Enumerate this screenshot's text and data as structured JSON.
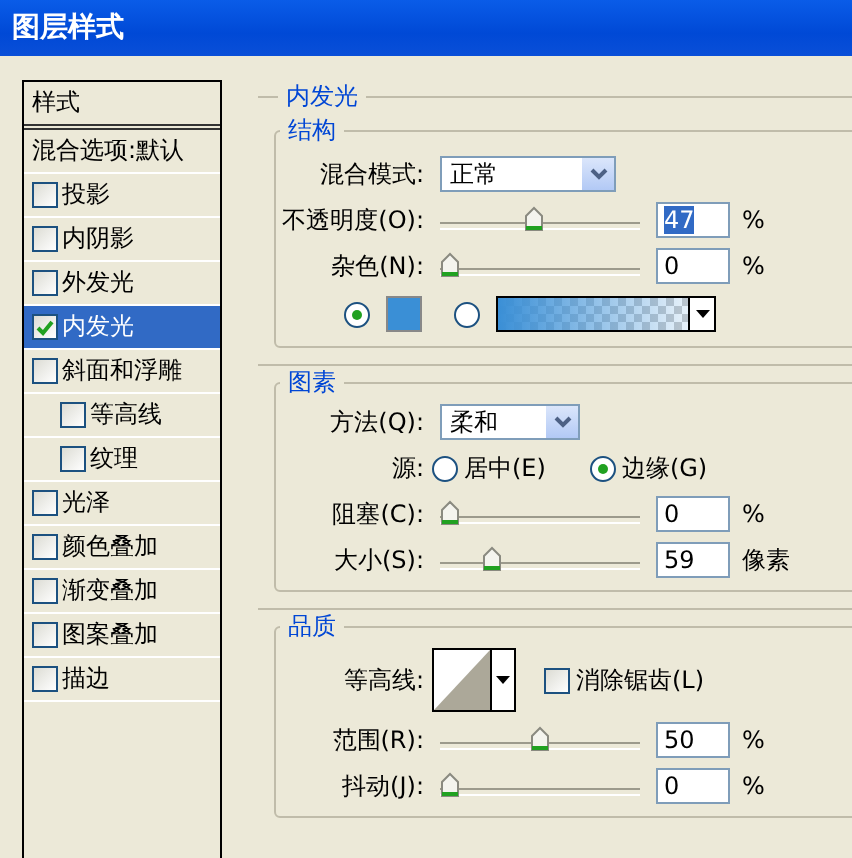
{
  "window": {
    "title": "图层样式"
  },
  "sidebar": {
    "header": "样式",
    "blending": "混合选项:默认",
    "items": [
      {
        "label": "投影",
        "checked": false,
        "selected": false
      },
      {
        "label": "内阴影",
        "checked": false,
        "selected": false
      },
      {
        "label": "外发光",
        "checked": false,
        "selected": false
      },
      {
        "label": "内发光",
        "checked": true,
        "selected": true
      },
      {
        "label": "斜面和浮雕",
        "checked": false,
        "selected": false,
        "children": [
          {
            "label": "等高线",
            "checked": false,
            "selected": false
          },
          {
            "label": "纹理",
            "checked": false,
            "selected": false
          }
        ]
      },
      {
        "label": "光泽",
        "checked": false,
        "selected": false
      },
      {
        "label": "颜色叠加",
        "checked": false,
        "selected": false
      },
      {
        "label": "渐变叠加",
        "checked": false,
        "selected": false
      },
      {
        "label": "图案叠加",
        "checked": false,
        "selected": false
      },
      {
        "label": "描边",
        "checked": false,
        "selected": false
      }
    ]
  },
  "panel": {
    "title": "内发光",
    "structure": {
      "title": "结构",
      "blend_mode": {
        "label": "混合模式:",
        "value": "正常"
      },
      "sliders": [
        {
          "label": "不透明度(O):",
          "level": 0.47,
          "value": "47",
          "unit": "%",
          "highlighted": true
        },
        {
          "label": "杂色(N):",
          "level": 0,
          "value": "0",
          "unit": "%",
          "highlighted": false
        }
      ],
      "fill": {
        "color": "#3a8fd6",
        "color_selected": true,
        "gradient_selected": false
      }
    },
    "elements": {
      "title": "图素",
      "method": {
        "label": "方法(Q):",
        "value": "柔和"
      },
      "source": {
        "label": "源:",
        "options": [
          {
            "label": "居中(E)",
            "selected": false
          },
          {
            "label": "边缘(G)",
            "selected": true
          }
        ]
      },
      "sliders": [
        {
          "label": "阻塞(C):",
          "level": 0,
          "value": "0",
          "unit": "%",
          "highlighted": false
        },
        {
          "label": "大小(S):",
          "level": 0.236,
          "value": "59",
          "unit": "像素",
          "highlighted": false
        }
      ]
    },
    "quality": {
      "title": "品质",
      "contour_label": "等高线:",
      "antialias": {
        "label": "消除锯齿(L)",
        "checked": false
      },
      "sliders": [
        {
          "label": "范围(R):",
          "level": 0.5,
          "value": "50",
          "unit": "%",
          "highlighted": false
        },
        {
          "label": "抖动(J):",
          "level": 0,
          "value": "0",
          "unit": "%",
          "highlighted": false
        }
      ]
    }
  }
}
